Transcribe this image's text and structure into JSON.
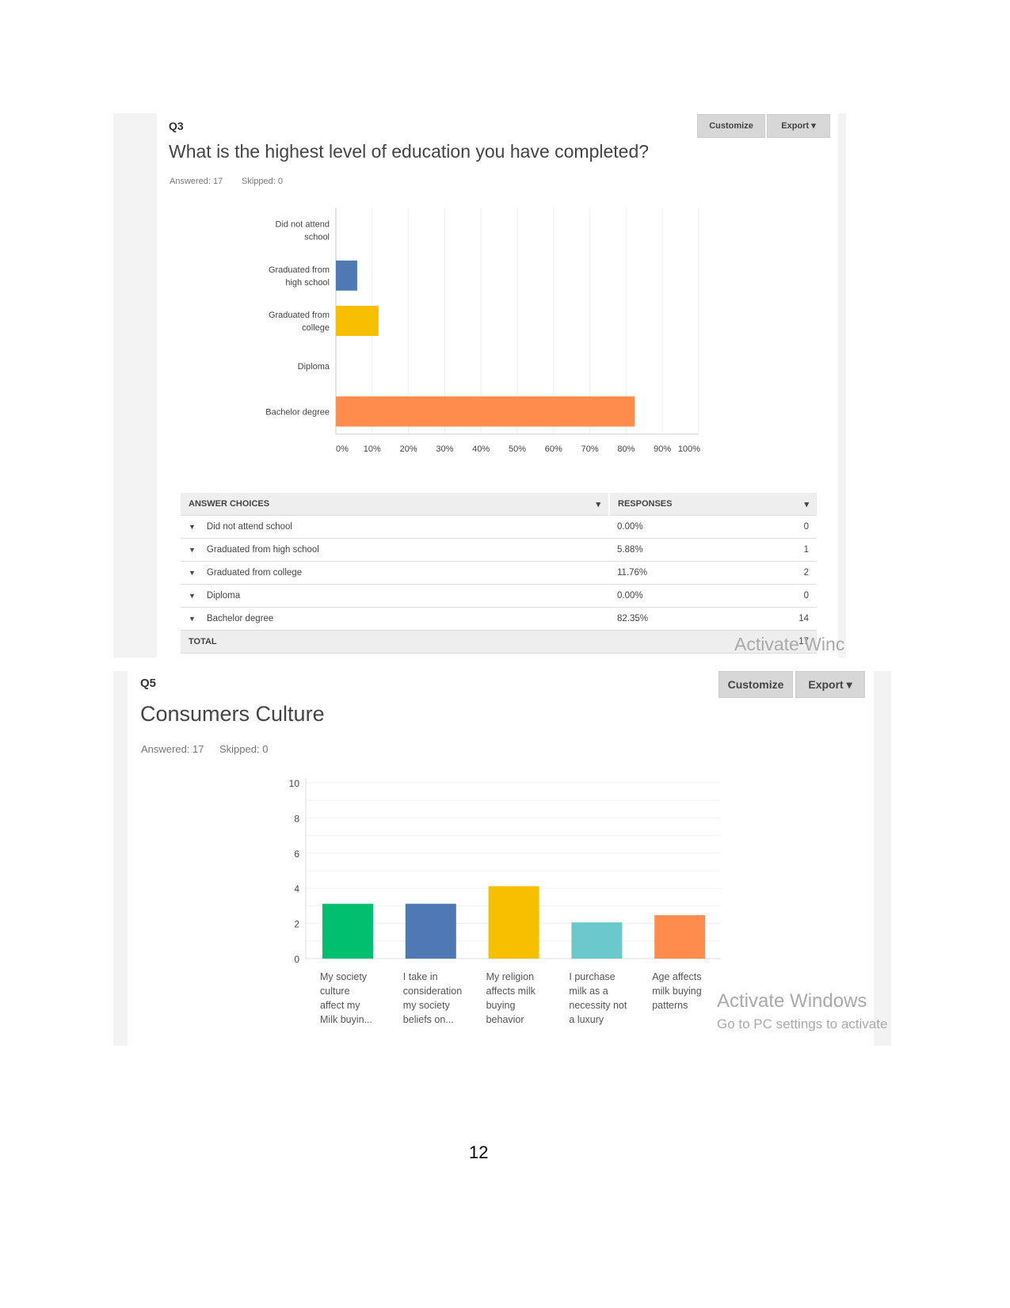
{
  "q3": {
    "number": "Q3",
    "title": "What is the highest level of education you have completed?",
    "answered": "Answered: 17",
    "skipped": "Skipped: 0",
    "customize": "Customize",
    "export": "Export",
    "table": {
      "col1": "ANSWER CHOICES",
      "col2": "RESPONSES",
      "rows": [
        {
          "choice": "Did not attend school",
          "pct": "0.00%",
          "count": "0"
        },
        {
          "choice": "Graduated from high school",
          "pct": "5.88%",
          "count": "1"
        },
        {
          "choice": "Graduated from college",
          "pct": "11.76%",
          "count": "2"
        },
        {
          "choice": "Diploma",
          "pct": "0.00%",
          "count": "0"
        },
        {
          "choice": "Bachelor degree",
          "pct": "82.35%",
          "count": "14"
        }
      ],
      "total_label": "TOTAL",
      "total": "17"
    }
  },
  "q5": {
    "number": "Q5",
    "title": "Consumers Culture",
    "answered": "Answered: 17",
    "skipped": "Skipped: 0",
    "customize": "Customize",
    "export": "Export"
  },
  "watermark1": "Activate Winc",
  "watermark2": {
    "line1": "Activate Windows",
    "line2": "Go to PC settings to activate"
  },
  "page_number": "12",
  "chart_data": [
    {
      "type": "bar",
      "orientation": "horizontal",
      "categories": [
        "Did not attend school",
        "Graduated from high school",
        "Graduated from college",
        "Diploma",
        "Bachelor degree"
      ],
      "category_lines": [
        [
          "Did not attend",
          "school"
        ],
        [
          "Graduated from",
          "high school"
        ],
        [
          "Graduated from",
          "college"
        ],
        [
          "Diploma"
        ],
        [
          "Bachelor degree"
        ]
      ],
      "values": [
        0,
        5.88,
        11.76,
        0,
        82.35
      ],
      "colors": [
        "#4e79b5",
        "#4e79b5",
        "#f7bf00",
        "#4e79b5",
        "#ff8b4c"
      ],
      "xlim": [
        0,
        100
      ],
      "xticks": [
        "0%",
        "10%",
        "20%",
        "30%",
        "40%",
        "50%",
        "60%",
        "70%",
        "80%",
        "90%",
        "100%"
      ],
      "grid": true
    },
    {
      "type": "bar",
      "categories": [
        "My society culture affect my Milk buyin...",
        "I take in consideration my society beliefs on...",
        "My religion affects milk buying behavior",
        "I purchase milk as a necessity not a luxury",
        "Age affects milk buying patterns"
      ],
      "category_lines": [
        [
          "My society",
          "culture",
          "affect my",
          "Milk buyin..."
        ],
        [
          "I take in",
          "consideration",
          "my society",
          "beliefs on..."
        ],
        [
          "My religion",
          "affects milk",
          "buying",
          "behavior"
        ],
        [
          "I purchase",
          "milk as a",
          "necessity not",
          "a luxury"
        ],
        [
          "Age affects",
          "milk buying",
          "patterns"
        ]
      ],
      "values": [
        3.12,
        3.12,
        4.12,
        2.06,
        2.47
      ],
      "colors": [
        "#00bf6f",
        "#4e79b5",
        "#f7bf00",
        "#6bc8cd",
        "#ff8b4c"
      ],
      "ylim": [
        0,
        10
      ],
      "yticks": [
        "0",
        "2",
        "4",
        "6",
        "8",
        "10"
      ],
      "grid": true
    }
  ]
}
